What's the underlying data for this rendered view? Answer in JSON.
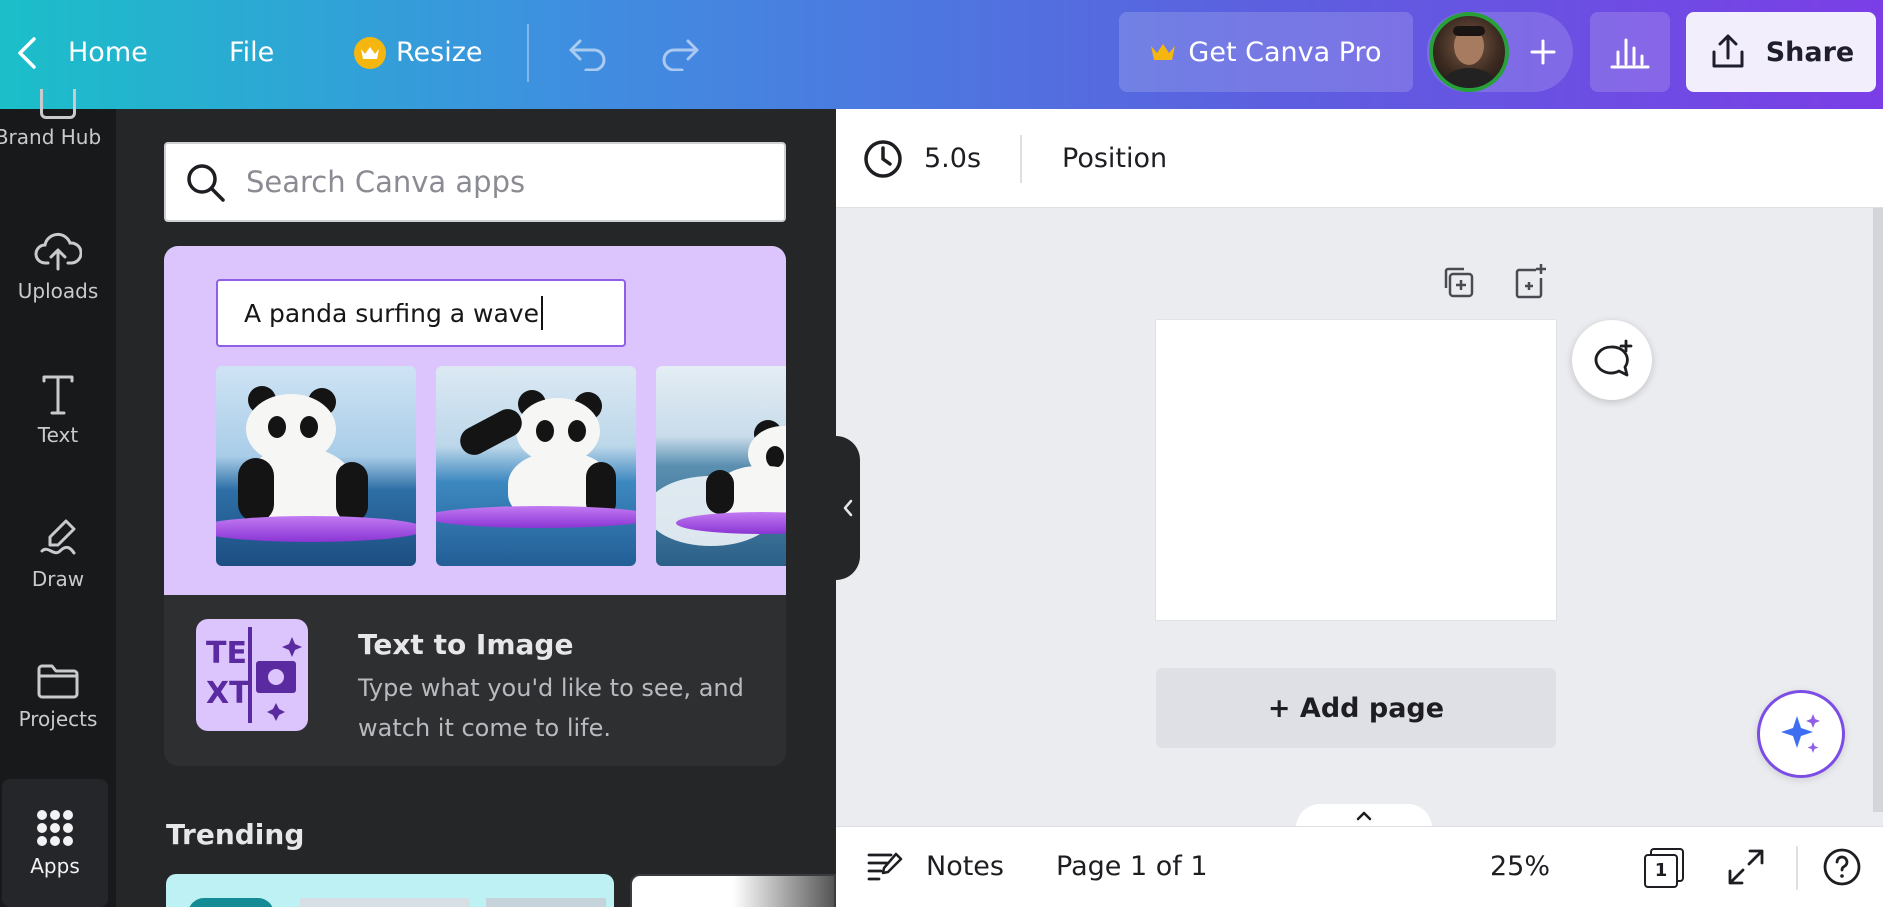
{
  "topbar": {
    "home_label": "Home",
    "file_label": "File",
    "resize_label": "Resize",
    "get_pro_label": "Get Canva Pro",
    "share_label": "Share"
  },
  "rail": {
    "items": [
      {
        "label": "Brand Hub",
        "icon": "brand-hub-icon"
      },
      {
        "label": "Uploads",
        "icon": "cloud-upload-icon"
      },
      {
        "label": "Text",
        "icon": "text-icon"
      },
      {
        "label": "Draw",
        "icon": "draw-icon"
      },
      {
        "label": "Projects",
        "icon": "folder-icon"
      },
      {
        "label": "Apps",
        "icon": "apps-grid-icon",
        "active": true
      }
    ]
  },
  "panel": {
    "search_placeholder": "Search Canva apps",
    "featured": {
      "prompt_text": "A panda surfing a wave",
      "app_title": "Text to Image",
      "app_description": "Type what you'd like to see, and watch it come to life."
    },
    "trending_label": "Trending"
  },
  "toolbar": {
    "duration": "5.0s",
    "position_label": "Position"
  },
  "canvas": {
    "add_page_label": "+ Add page"
  },
  "bottombar": {
    "notes_label": "Notes",
    "page_indicator": "Page 1 of 1",
    "zoom": "25%",
    "page_count": "1"
  },
  "colors": {
    "accent": "#7d2ae8",
    "panel_bg": "#252627",
    "featured_bg": "#dcc4fd"
  }
}
